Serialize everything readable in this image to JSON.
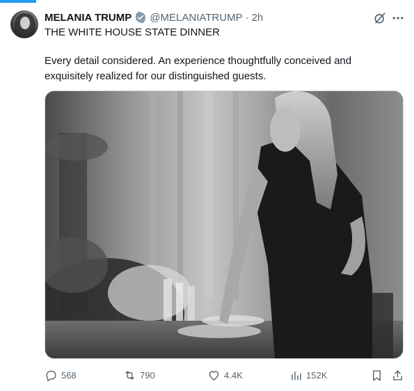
{
  "tweet": {
    "author_name": "MELANIA TRUMP",
    "handle": "@MELANIATRUMP",
    "separator": "·",
    "time": "2h",
    "title_line": "THE WHITE HOUSE STATE DINNER",
    "text": "Every detail considered. An experience thoughtfully conceived and exquisitely realized for our distinguished guests."
  },
  "icons": {
    "verified": "verified-badge-icon",
    "grok": "grok-icon",
    "more": "more-icon",
    "reply": "reply-icon",
    "repost": "repost-icon",
    "like": "like-icon",
    "views": "views-icon",
    "bookmark": "bookmark-icon",
    "share": "share-icon"
  },
  "actions": {
    "replies": "568",
    "reposts": "790",
    "likes": "4.4K",
    "views": "152K"
  },
  "colors": {
    "accent": "#1d9bf0",
    "secondary_text": "#536471",
    "verified_badge": "#829aab"
  }
}
